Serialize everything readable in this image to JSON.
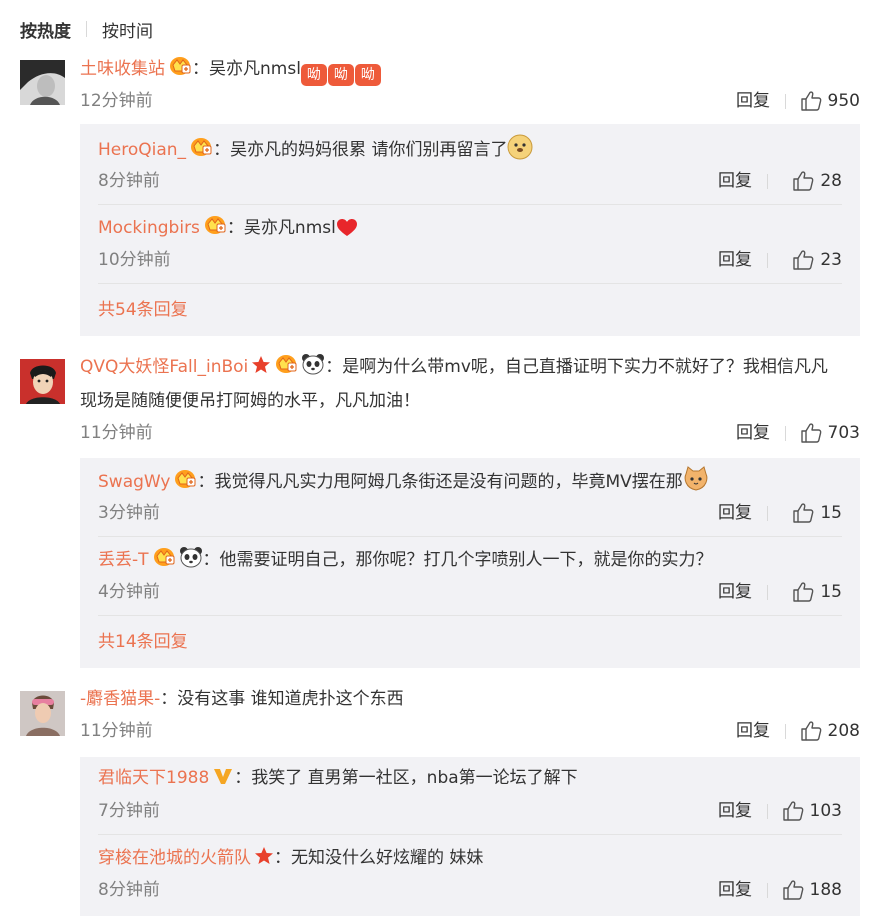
{
  "sort": {
    "hot": "按热度",
    "time": "按时间"
  },
  "colors": {
    "username": "#eb7350",
    "subbox": "#f2f2f5",
    "text": "#333333",
    "meta": "#808080"
  },
  "threads": [
    {
      "user": "土味收集站",
      "colon": "：",
      "text": "吴亦凡nmsl",
      "emoji_text": "呦",
      "time": "12分钟前",
      "reply": "回复",
      "likes": "950",
      "replies": [
        {
          "user": "HeroQian_",
          "colon": "：",
          "text": "吴亦凡的妈妈很累 请你们别再留言了",
          "time": "8分钟前",
          "reply": "回复",
          "likes": "28"
        },
        {
          "user": "Mockingbirs",
          "colon": "：",
          "text": "吴亦凡nmsl",
          "time": "10分钟前",
          "reply": "回复",
          "likes": "23"
        }
      ],
      "more": "共54条回复"
    },
    {
      "user": "QVQ大妖怪Fall_inBoi",
      "colon": "：",
      "text1": "是啊为什么带mv呢，自己直播证明下实力不就好了？我相信凡凡",
      "text2": "现场是随随便便吊打阿姆的水平，凡凡加油！",
      "time": "11分钟前",
      "reply": "回复",
      "likes": "703",
      "replies": [
        {
          "user": "SwagWy",
          "colon": "：",
          "text": "我觉得凡凡实力甩阿姆几条街还是没有问题的，毕竟MV摆在那",
          "time": "3分钟前",
          "reply": "回复",
          "likes": "15"
        },
        {
          "user": "丢丢-T",
          "colon": "：",
          "text": "他需要证明自己，那你呢？打几个字喷别人一下，就是你的实力？",
          "time": "4分钟前",
          "reply": "回复",
          "likes": "15"
        }
      ],
      "more": "共14条回复"
    },
    {
      "user": "-麝香猫果-",
      "colon": "：",
      "text": "没有这事 谁知道虎扑这个东西",
      "time": "11分钟前",
      "reply": "回复",
      "likes": "208",
      "replies": [
        {
          "user": "君临天下1988",
          "colon": "：",
          "text": "我笑了  直男第一社区，nba第一论坛了解下",
          "time": "7分钟前",
          "reply": "回复",
          "likes": "103"
        },
        {
          "user": "穿梭在池城的火箭队",
          "colon": "：",
          "text": "无知没什么好炫耀的 妹妹",
          "time": "8分钟前",
          "reply": "回复",
          "likes": "188"
        }
      ]
    }
  ]
}
